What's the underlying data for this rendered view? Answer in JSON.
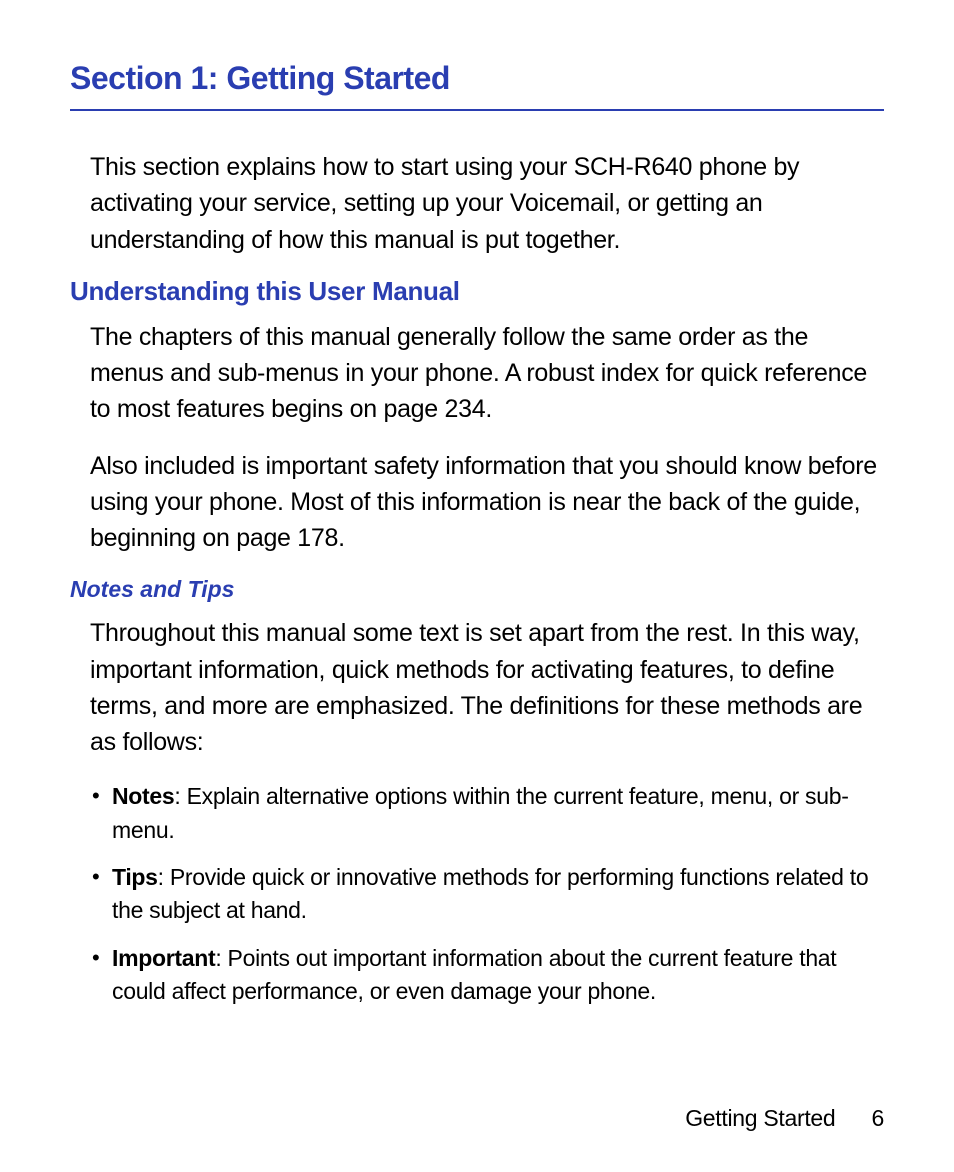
{
  "section_title": "Section 1: Getting Started",
  "intro": "This section explains how to start using your SCH-R640 phone by activating your service, setting up your Voicemail, or getting an understanding of how this manual is put together.",
  "subheading1": "Understanding this User Manual",
  "para1": "The chapters of this manual generally follow the same order as the menus and sub-menus in your phone. A robust index for quick reference to most features begins on page 234.",
  "para2": "Also included is important safety information that you should know before using your phone. Most of this information is near the back of the guide, beginning on page 178.",
  "subsubheading": "Notes and Tips",
  "para3": "Throughout this manual some text is set apart from the rest. In this way, important information, quick methods for activating features, to define terms, and more are emphasized. The definitions for these methods are as follows:",
  "bullets": [
    {
      "lead": "Notes",
      "text": ": Explain alternative options within the current feature, menu, or sub-menu."
    },
    {
      "lead": "Tips",
      "text": ": Provide quick or innovative methods for performing functions related to the subject at hand."
    },
    {
      "lead": "Important",
      "text": ": Points out important information about the current feature that could affect performance, or even damage your phone."
    }
  ],
  "footer_label": "Getting Started",
  "page_number": "6"
}
